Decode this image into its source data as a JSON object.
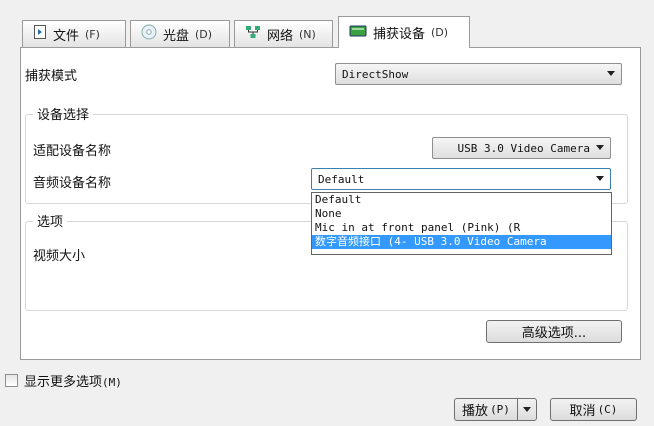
{
  "tabs": [
    {
      "label": "文件",
      "shortcut": "(F)",
      "icon": "file-icon"
    },
    {
      "label": "光盘",
      "shortcut": "(D)",
      "icon": "disc-icon"
    },
    {
      "label": "网络",
      "shortcut": "(N)",
      "icon": "network-icon"
    },
    {
      "label": "捕获设备",
      "shortcut": "(D)",
      "icon": "capture-device-icon",
      "active": true
    }
  ],
  "capture_mode": {
    "label": "捕获模式",
    "value": "DirectShow"
  },
  "device_group": {
    "title": "设备选择",
    "video_device": {
      "label": "适配设备名称",
      "value": "USB 3.0 Video Camera"
    },
    "audio_device": {
      "label": "音频设备名称",
      "value": "Default",
      "options": [
        "Default",
        "None",
        "Mic in at front panel (Pink) (R",
        "数字音频接口 (4- USB 3.0 Video Camera"
      ],
      "highlighted_index": 3
    }
  },
  "options_group": {
    "title": "选项",
    "video_size_label": "视频大小"
  },
  "advanced_button": "高级选项...",
  "show_more": {
    "label": "显示更多选项",
    "shortcut": "(M)",
    "checked": false
  },
  "play_button": {
    "label": "播放",
    "shortcut": "(P)"
  },
  "cancel_button": {
    "label": "取消",
    "shortcut": "(C)"
  },
  "colors": {
    "selection": "#3399ff",
    "focus_border": "#3c7fb1"
  }
}
